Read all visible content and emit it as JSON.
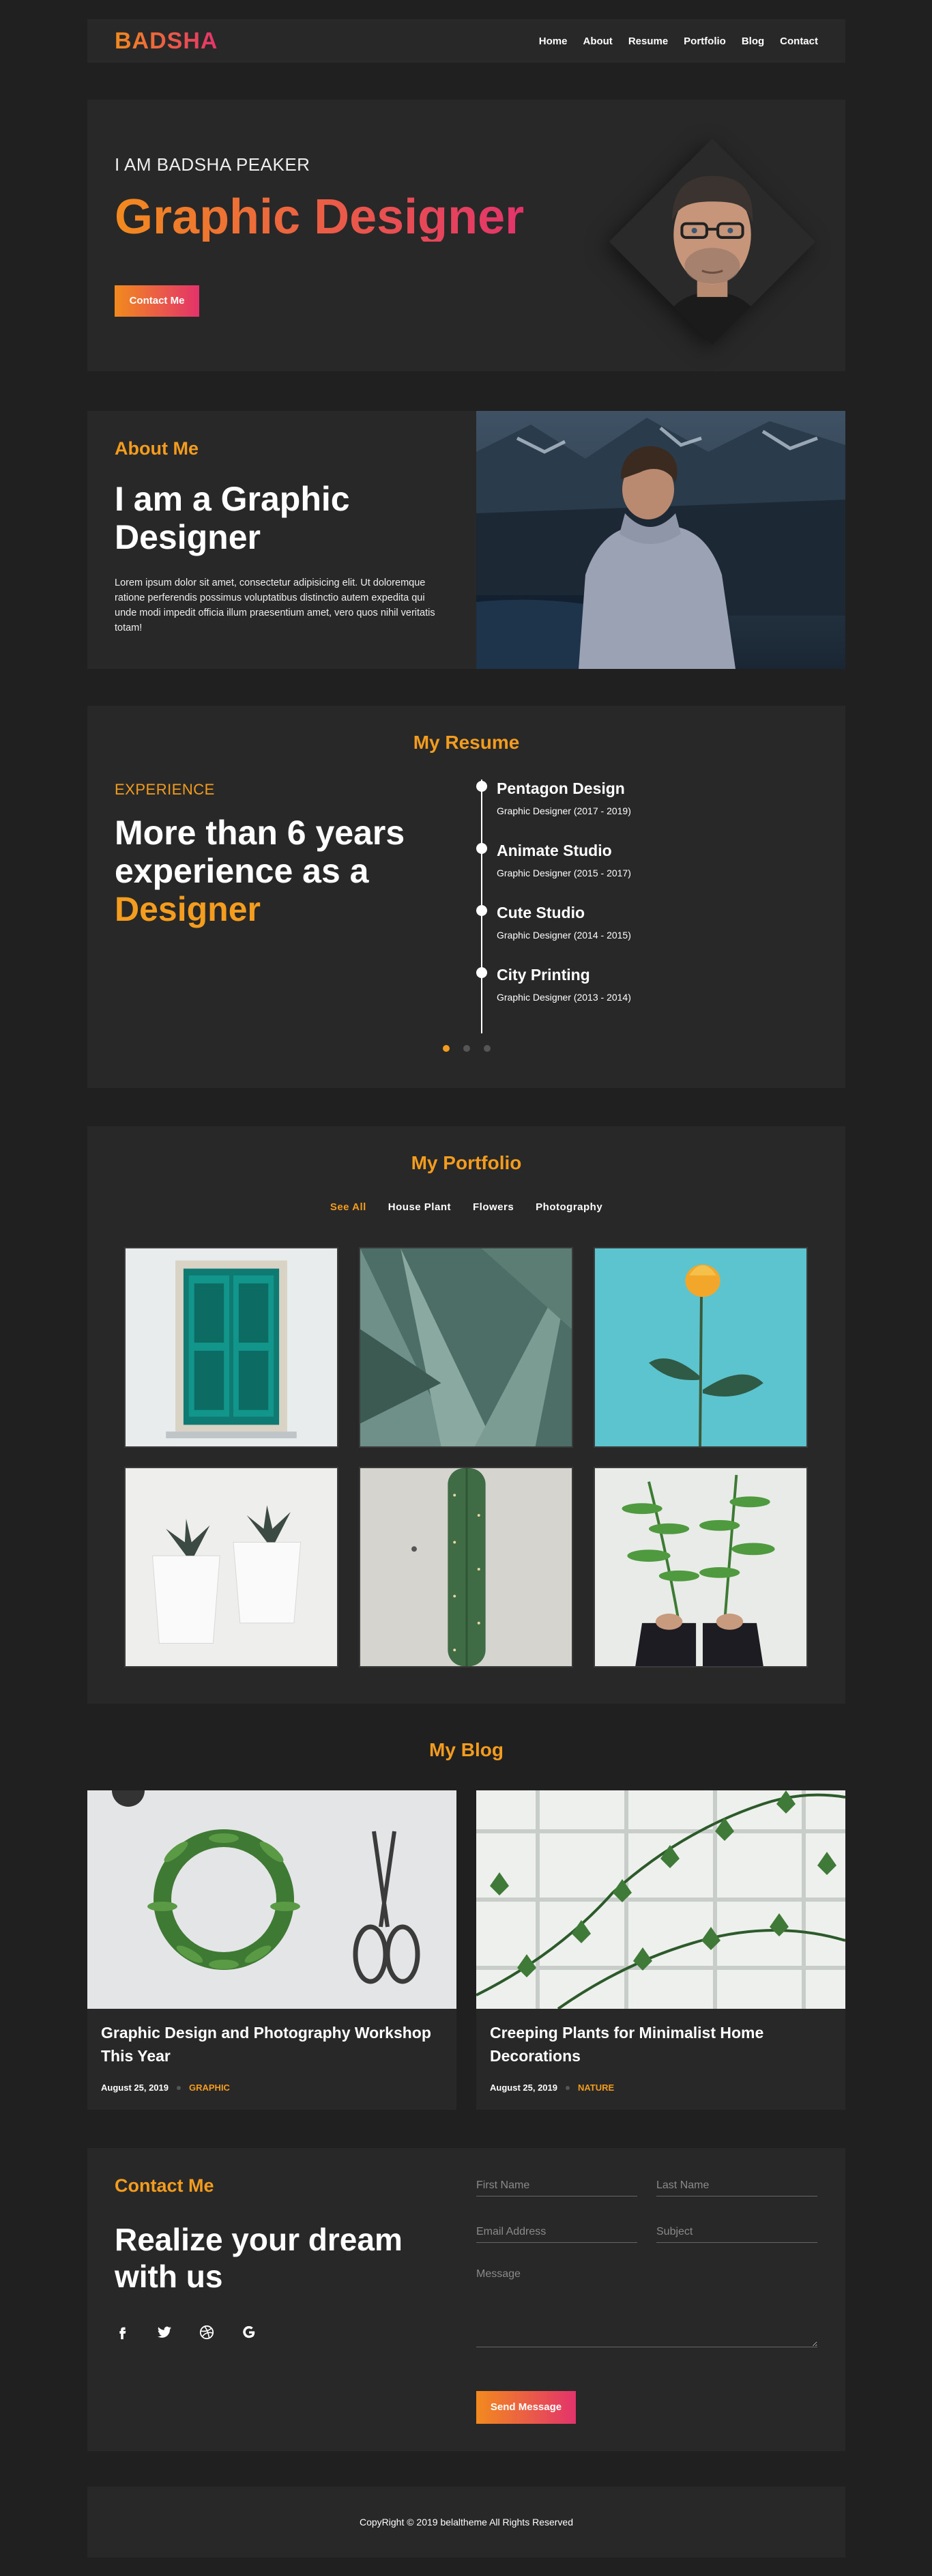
{
  "brand": {
    "logo": "BADSHA"
  },
  "nav": {
    "items": [
      "Home",
      "About",
      "Resume",
      "Portfolio",
      "Blog",
      "Contact"
    ]
  },
  "hero": {
    "subtitle": "I AM BADSHA PEAKER",
    "title": "Graphic Designer",
    "button": "Contact Me"
  },
  "about": {
    "kicker": "About Me",
    "title": "I am a Graphic Designer",
    "text": "Lorem ipsum dolor sit amet, consectetur adipisicing elit. Ut doloremque ratione perferendis possimus voluptatibus distinctio autem expedita qui unde modi impedit officia illum praesentium amet, vero quos nihil veritatis totam!"
  },
  "resume": {
    "title": "My Resume",
    "kicker": "EXPERIENCE",
    "headline": "More than 6 years experience as a",
    "headline_accent": "Designer",
    "items": [
      {
        "name": "Pentagon Design",
        "role": "Graphic Designer (2017 - 2019)"
      },
      {
        "name": "Animate Studio",
        "role": "Graphic Designer (2015 - 2017)"
      },
      {
        "name": "Cute Studio",
        "role": "Graphic Designer (2014 - 2015)"
      },
      {
        "name": "City Printing",
        "role": "Graphic Designer (2013 - 2014)"
      }
    ],
    "active_page": 1,
    "pages": 3
  },
  "portfolio": {
    "title": "My Portfolio",
    "filters": [
      "See All",
      "House Plant",
      "Flowers",
      "Photography"
    ],
    "active_filter": "See All",
    "items": [
      "teal-door",
      "agave-leaves",
      "yellow-rose",
      "potted-succulents",
      "cactus",
      "fern-leaves"
    ]
  },
  "blog": {
    "title": "My Blog",
    "posts": [
      {
        "title": "Graphic Design and Photography Workshop This Year",
        "date": "August 25, 2019",
        "category": "GRAPHIC"
      },
      {
        "title": "Creeping Plants for Minimalist Home Decorations",
        "date": "August 25, 2019",
        "category": "NATURE"
      }
    ]
  },
  "contact": {
    "kicker": "Contact Me",
    "title": "Realize your dream with us",
    "socials": [
      "facebook-icon",
      "twitter-icon",
      "dribbble-icon",
      "google-icon"
    ],
    "form": {
      "first_name": "First Name",
      "last_name": "Last Name",
      "email": "Email Address",
      "subject": "Subject",
      "message": "Message",
      "button": "Send Message"
    }
  },
  "footer": {
    "text": "CopyRight © 2019 belaltheme All Rights Reserved"
  },
  "colors": {
    "accent": "#f39c1d",
    "gradient_start": "#f28a1e",
    "gradient_end": "#e3336b",
    "card": "#282828",
    "background": "#202020"
  }
}
